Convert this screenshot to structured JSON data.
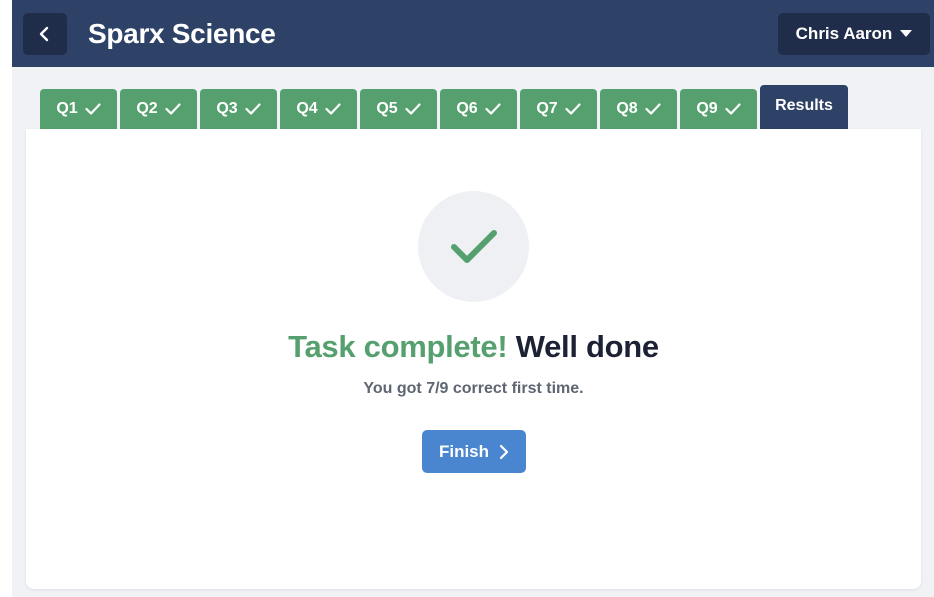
{
  "header": {
    "title": "Sparx Science",
    "user_name": "Chris Aaron"
  },
  "tabs": [
    {
      "label": "Q1",
      "status": "complete"
    },
    {
      "label": "Q2",
      "status": "complete"
    },
    {
      "label": "Q3",
      "status": "complete"
    },
    {
      "label": "Q4",
      "status": "complete"
    },
    {
      "label": "Q5",
      "status": "complete"
    },
    {
      "label": "Q6",
      "status": "complete"
    },
    {
      "label": "Q7",
      "status": "complete"
    },
    {
      "label": "Q8",
      "status": "complete"
    },
    {
      "label": "Q9",
      "status": "complete"
    },
    {
      "label": "Results",
      "status": "active"
    }
  ],
  "result": {
    "headline_green": "Task complete!",
    "headline_dark": "Well done",
    "score_text": "You got 7/9 correct first time.",
    "finish_label": "Finish"
  },
  "colors": {
    "header_bg": "#2e4166",
    "tab_complete": "#55a06e",
    "tab_active": "#2e4166",
    "accent_green": "#55a06e",
    "button_blue": "#4a86cf"
  },
  "icons": {
    "back": "chevron-left-icon",
    "user_menu": "caret-down-icon",
    "tab_check": "check-icon",
    "result": "check-icon",
    "finish": "chevron-right-icon"
  }
}
